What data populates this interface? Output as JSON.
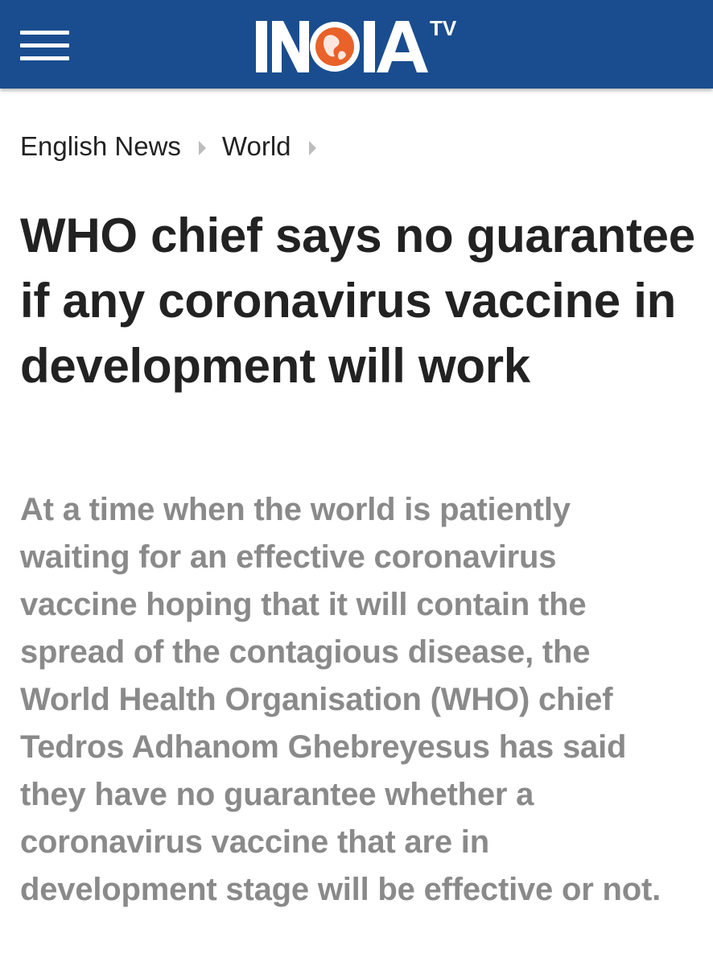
{
  "header": {
    "background_color": "#1a4d8f",
    "menu_icon": "hamburger-menu-icon",
    "logo": {
      "text": "INDIA",
      "superscript": "TV",
      "globe_color": "#e8622a"
    }
  },
  "breadcrumb": {
    "items": [
      {
        "label": "English News"
      },
      {
        "label": "World"
      }
    ],
    "separator_icon": "chevron-right-icon"
  },
  "article": {
    "headline": "WHO chief says no guarantee if any coronavirus vaccine in development will work",
    "summary": "At a time when the world is patiently waiting for an effective coronavirus vaccine hoping that it will contain the spread of the contagious disease, the World Health Organisation (WHO) chief Tedros Adhanom Ghebreyesus has said they have no guarantee whether a coronavirus vaccine that are in development stage will be effective or not."
  }
}
